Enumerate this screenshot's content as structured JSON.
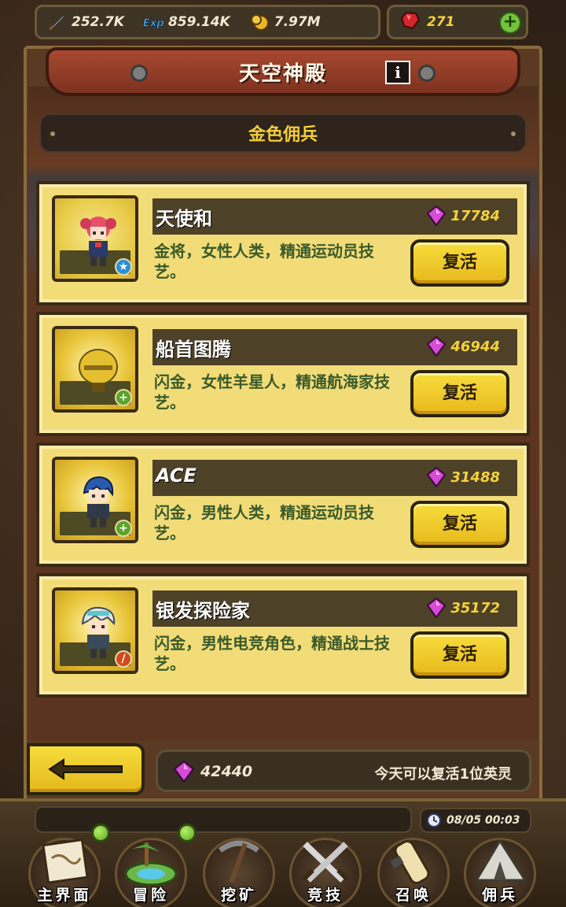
{
  "resources": {
    "attack": {
      "icon": "sword-icon",
      "value": "252.7K"
    },
    "exp": {
      "icon": "exp-icon",
      "value": "859.14K"
    },
    "gold": {
      "icon": "gold-coin-icon",
      "value": "7.97M"
    },
    "ruby": {
      "icon": "ruby-icon",
      "value": "271"
    }
  },
  "header": {
    "title": "天空神殿",
    "info_label": "i"
  },
  "subheader": {
    "title": "金色佣兵"
  },
  "heroes": [
    {
      "name": "天使和",
      "cost": "17784",
      "description": "金将，女性人类，精通运动员技艺。",
      "button": "复活",
      "badge_icon": "star-icon",
      "badge_color": "#2a8fd6"
    },
    {
      "name": "船首图腾",
      "cost": "46944",
      "description": "闪金，女性羊星人，精通航海家技艺。",
      "button": "复活",
      "badge_icon": "plus-icon",
      "badge_color": "#5aa52a"
    },
    {
      "name": "ACE",
      "cost": "31488",
      "description": "闪金，男性人类，精通运动员技艺。",
      "button": "复活",
      "badge_icon": "plus-icon",
      "badge_color": "#5aa52a"
    },
    {
      "name": "银发探险家",
      "cost": "35172",
      "description": "闪金，男性电竞角色，精通战士技艺。",
      "button": "复活",
      "badge_icon": "sword-badge-icon",
      "badge_color": "#d24a1e"
    }
  ],
  "footer": {
    "total_gems": "42440",
    "note": "今天可以复活1位英灵",
    "datetime": "08/05 00:03"
  },
  "nav": [
    {
      "label": "主界面",
      "icon": "map-scroll-icon"
    },
    {
      "label": "冒险",
      "icon": "island-icon"
    },
    {
      "label": "挖矿",
      "icon": "pickaxe-icon"
    },
    {
      "label": "竞技",
      "icon": "crossed-swords-icon"
    },
    {
      "label": "召唤",
      "icon": "summon-scroll-icon"
    },
    {
      "label": "佣兵",
      "icon": "tent-icon"
    }
  ],
  "colors": {
    "gold_text": "#f5d23a",
    "card_bg": "#f2dc78",
    "button_yellow": "#f6dc3c",
    "banner_red": "#a8482f"
  }
}
